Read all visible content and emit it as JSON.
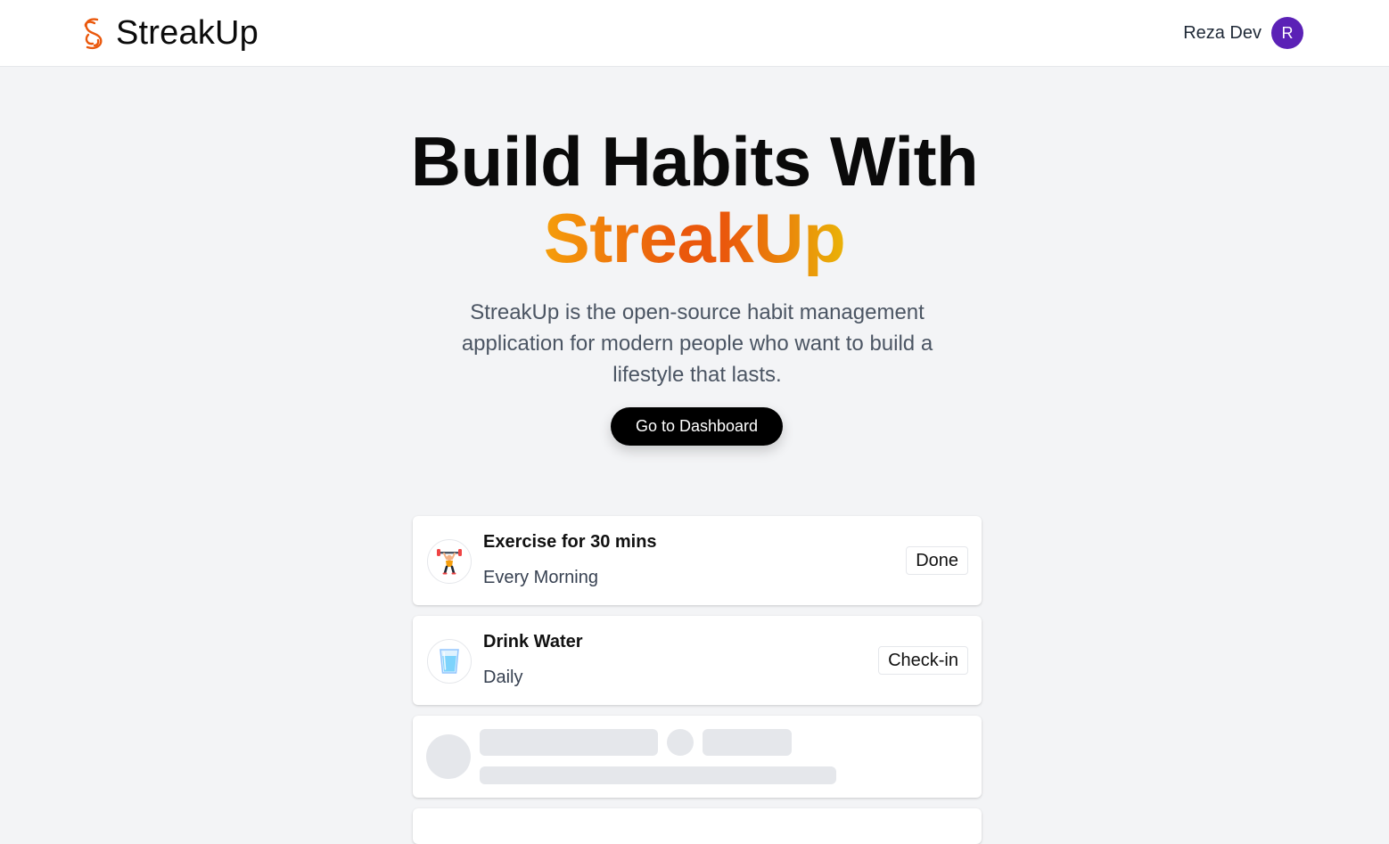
{
  "header": {
    "brand_name": "StreakUp",
    "logo_icon": "streak-swirl-icon",
    "user_name": "Reza Dev",
    "avatar_initial": "R"
  },
  "hero": {
    "title_line1": "Build Habits With",
    "title_accent": "StreakUp",
    "subtitle": "StreakUp is the open-source habit management application for modern people who want to build a lifestyle that lasts.",
    "cta_label": "Go to Dashboard"
  },
  "habits": [
    {
      "title": "Exercise for 30 mins",
      "frequency": "Every Morning",
      "action_label": "Done",
      "icon": "weightlifter-icon"
    },
    {
      "title": "Drink Water",
      "frequency": "Daily",
      "action_label": "Check-in",
      "icon": "glass-of-water-icon"
    }
  ],
  "colors": {
    "avatar_bg": "#5b21b6",
    "accent_orange": "#ea580c",
    "accent_yellow": "#eab308",
    "cta_bg": "#000000",
    "page_bg": "#f3f4f6"
  }
}
